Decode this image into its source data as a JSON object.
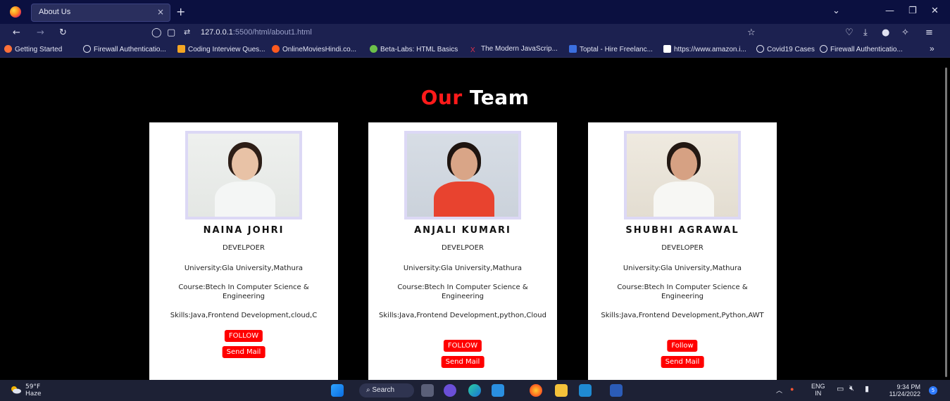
{
  "browser": {
    "tab_title": "About Us",
    "new_tab": "+",
    "tab_close": "×",
    "url_host": "127.0.0.1",
    "url_rest": ":5500/html/about1.html",
    "bookmarks": [
      {
        "label": "Getting Started",
        "color": "#ff7139"
      },
      {
        "label": "Firewall Authenticatio...",
        "color": "#dfe1f0"
      },
      {
        "label": "Coding Interview Ques...",
        "color": "#f5a623"
      },
      {
        "label": "OnlineMoviesHindi.co...",
        "color": "#ff5a1f"
      },
      {
        "label": "Beta-Labs: HTML Basics",
        "color": "#6cc04a"
      },
      {
        "label": "The Modern JavaScrip...",
        "color": "#e0324b"
      },
      {
        "label": "Toptal - Hire Freelanc...",
        "color": "#3b6fe0"
      },
      {
        "label": "https://www.amazon.i...",
        "color": "#ffffff"
      },
      {
        "label": "Covid19 Cases",
        "color": "#dfe1f0"
      },
      {
        "label": "Firewall Authenticatio...",
        "color": "#dfe1f0"
      }
    ],
    "bookmarks_more": "»"
  },
  "page": {
    "heading_red": "Our",
    "heading_white": "Team",
    "members": [
      {
        "name": "NAINA JOHRI",
        "role": "DEVELPOER",
        "university": "University:Gla University,Mathura",
        "course": "Course:Btech In Computer Science & Engineering",
        "skills": "Skills:Java,Frontend Development,cloud,C",
        "follow": "FOLLOW",
        "mail": "Send Mail"
      },
      {
        "name": "ANJALI KUMARI",
        "role": "DEVELPOER",
        "university": "University:Gla University,Mathura",
        "course": "Course:Btech In Computer Science & Engineering",
        "skills": "Skills:Java,Frontend Development,python,Cloud",
        "follow": "FOLLOW",
        "mail": "Send Mail"
      },
      {
        "name": "SHUBHI AGRAWAL",
        "role": "DEVELOPER",
        "university": "University:Gla University,Mathura",
        "course": "Course:Btech In Computer Science & Engineering",
        "skills": "Skills:Java,Frontend Development,Python,AWT",
        "follow": "Follow",
        "mail": "Send Mail"
      }
    ]
  },
  "taskbar": {
    "temp": "59°F",
    "weather": "Haze",
    "search": "Search",
    "lang_top": "ENG",
    "lang_bottom": "IN",
    "time": "9:34 PM",
    "date": "11/24/2022",
    "notifications": "5"
  },
  "colors": {
    "accent_red": "#ff0000",
    "page_bg": "#000000",
    "card_bg": "#ffffff",
    "photo_frame": "#dcd8f5"
  }
}
